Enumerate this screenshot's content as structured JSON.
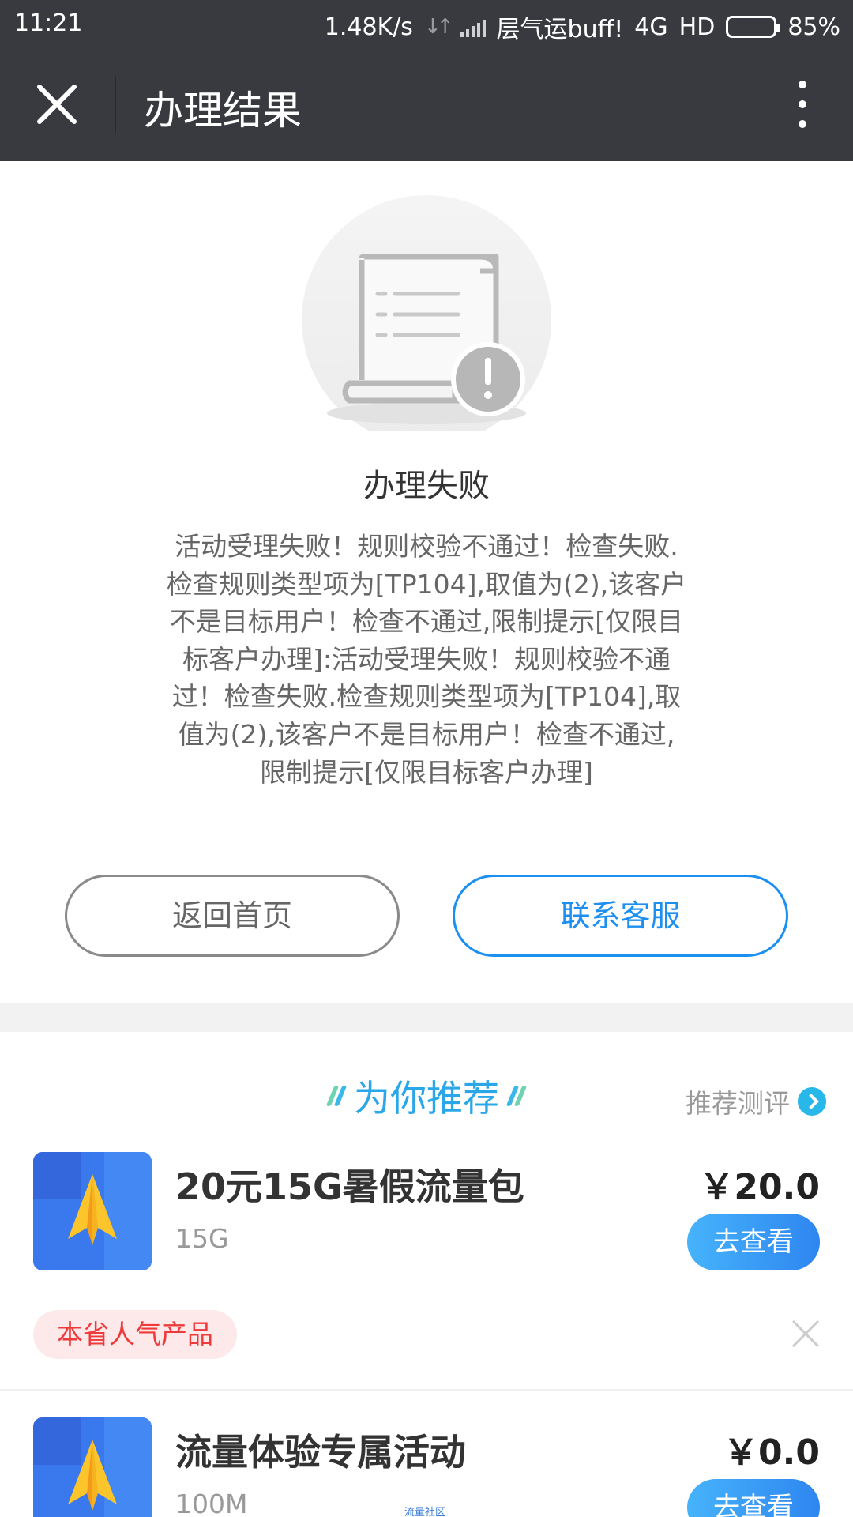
{
  "status_bar": {
    "time": "11:21",
    "speed": "1.48K/s",
    "carrier": "层气运buff!",
    "network": "4G",
    "hd": "HD",
    "battery_percent": "85%",
    "battery_level": 0.85,
    "battery_color": "#ff9a1c"
  },
  "nav": {
    "title": "办理结果",
    "close_icon": "close-icon",
    "more_icon": "more-vertical-icon"
  },
  "result": {
    "icon": "document-warning-icon",
    "title": "办理失败",
    "message": "活动受理失败！规则校验不通过！检查失败.检查规则类型项为[TP104],取值为(2),该客户不是目标用户！检查不通过,限制提示[仅限目标客户办理]:活动受理失败！规则校验不通过！检查失败.检查规则类型项为[TP104],取值为(2),该客户不是目标用户！检查不通过,限制提示[仅限目标客户办理]"
  },
  "actions": {
    "home_label": "返回首页",
    "service_label": "联系客服",
    "accent_color": "#1d8ff0"
  },
  "recommend": {
    "title": "为你推荐",
    "eval_label": "推荐测评",
    "products": [
      {
        "name": "20元15G暑假流量包",
        "spec": "15G",
        "price": "￥20.0",
        "button_label": "去查看",
        "tag": "本省人气产品"
      },
      {
        "name": "流量体验专属活动",
        "spec": "100M",
        "price": "￥0.0",
        "button_label": "去查看"
      }
    ]
  },
  "watermark": "流量社区"
}
